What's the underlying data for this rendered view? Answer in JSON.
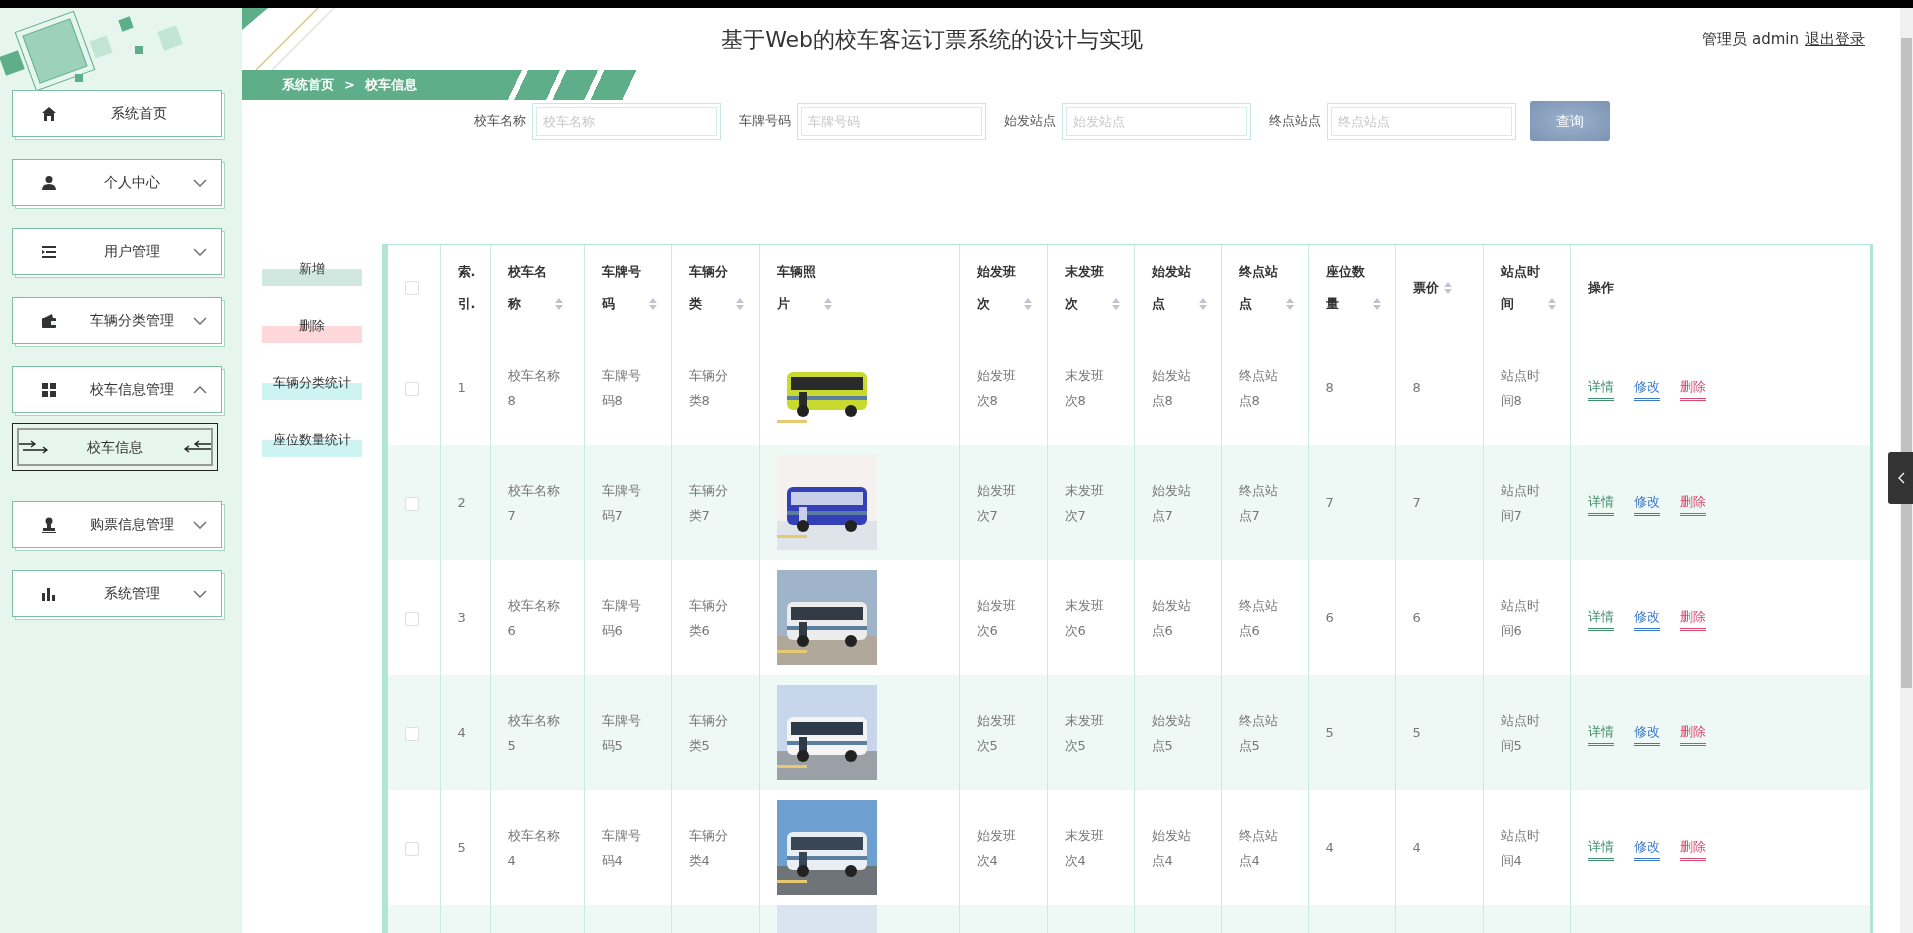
{
  "header": {
    "title": "基于Web的校车客运订票系统的设计与实现",
    "user": "管理员 admin",
    "logout": "退出登录"
  },
  "breadcrumb": {
    "home": "系统首页",
    "separator": ">",
    "current": "校车信息"
  },
  "sidebar": {
    "items": [
      {
        "label": "系统首页"
      },
      {
        "label": "个人中心",
        "expanded": false
      },
      {
        "label": "用户管理",
        "expanded": false
      },
      {
        "label": "车辆分类管理",
        "expanded": false
      },
      {
        "label": "校车信息管理",
        "expanded": true,
        "children": [
          {
            "label": "校车信息",
            "selected": true
          }
        ]
      },
      {
        "label": "购票信息管理",
        "expanded": false
      },
      {
        "label": "系统管理",
        "expanded": false
      }
    ]
  },
  "search": {
    "fields": [
      {
        "label": "校车名称",
        "placeholder": "校车名称"
      },
      {
        "label": "车牌号码",
        "placeholder": "车牌号码"
      },
      {
        "label": "始发站点",
        "placeholder": "始发站点"
      },
      {
        "label": "终点站点",
        "placeholder": "终点站点"
      }
    ],
    "button": "查询"
  },
  "actions": [
    {
      "label": "新增",
      "kind": "add"
    },
    {
      "label": "删除",
      "kind": "delete"
    },
    {
      "label": "车辆分类统计",
      "kind": "stat"
    },
    {
      "label": "座位数量统计",
      "kind": "stat"
    }
  ],
  "table": {
    "select_all": {
      "checked": false
    },
    "columns": [
      {
        "label": "索.引.",
        "sortable": false
      },
      {
        "label": "校车名称",
        "sortable": true
      },
      {
        "label": "车牌号码",
        "sortable": true
      },
      {
        "label": "车辆分类",
        "sortable": true
      },
      {
        "label": "车辆照片",
        "sortable": true
      },
      {
        "label": "始发班次",
        "sortable": true
      },
      {
        "label": "末发班次",
        "sortable": true
      },
      {
        "label": "始发站点",
        "sortable": true
      },
      {
        "label": "终点站点",
        "sortable": true
      },
      {
        "label": "座位数量",
        "sortable": true
      },
      {
        "label": "票价",
        "sortable": true
      },
      {
        "label": "站点时间",
        "sortable": true
      },
      {
        "label": "操作",
        "sortable": false
      }
    ],
    "rows": [
      {
        "checked": false,
        "cells": [
          "1",
          "校车名称8",
          "车牌号码8",
          "车辆分类8",
          {
            "kind": "picture"
          },
          "始发班次8",
          "末发班次8",
          "始发站点8",
          "终点站点8",
          "8",
          "8",
          "站点时间8"
        ],
        "actions": [
          {
            "label": "详情",
            "kind": "detail"
          },
          {
            "label": "修改",
            "kind": "edit"
          },
          {
            "label": "删除",
            "kind": "delete"
          }
        ]
      },
      {
        "checked": false,
        "cells": [
          "2",
          "校车名称7",
          "车牌号码7",
          "车辆分类7",
          {
            "kind": "picture"
          },
          "始发班次7",
          "末发班次7",
          "始发站点7",
          "终点站点7",
          "7",
          "7",
          "站点时间7"
        ],
        "actions": [
          {
            "label": "详情",
            "kind": "detail"
          },
          {
            "label": "修改",
            "kind": "edit"
          },
          {
            "label": "删除",
            "kind": "delete"
          }
        ]
      },
      {
        "checked": false,
        "cells": [
          "3",
          "校车名称6",
          "车牌号码6",
          "车辆分类6",
          {
            "kind": "picture"
          },
          "始发班次6",
          "末发班次6",
          "始发站点6",
          "终点站点6",
          "6",
          "6",
          "站点时间6"
        ],
        "actions": [
          {
            "label": "详情",
            "kind": "detail"
          },
          {
            "label": "修改",
            "kind": "edit"
          },
          {
            "label": "删除",
            "kind": "delete"
          }
        ]
      },
      {
        "checked": false,
        "cells": [
          "4",
          "校车名称5",
          "车牌号码5",
          "车辆分类5",
          {
            "kind": "picture"
          },
          "始发班次5",
          "末发班次5",
          "始发站点5",
          "终点站点5",
          "5",
          "5",
          "站点时间5"
        ],
        "actions": [
          {
            "label": "详情",
            "kind": "detail"
          },
          {
            "label": "修改",
            "kind": "edit"
          },
          {
            "label": "删除",
            "kind": "delete"
          }
        ]
      },
      {
        "checked": false,
        "cells": [
          "5",
          "校车名称4",
          "车牌号码4",
          "车辆分类4",
          {
            "kind": "picture"
          },
          "始发班次4",
          "末发班次4",
          "始发站点4",
          "终点站点4",
          "4",
          "4",
          "站点时间4"
        ],
        "actions": [
          {
            "label": "详情",
            "kind": "detail"
          },
          {
            "label": "修改",
            "kind": "edit"
          },
          {
            "label": "删除",
            "kind": "delete"
          }
        ]
      },
      {
        "kind": "cut",
        "cells": [
          {
            "kind": "picture"
          }
        ]
      }
    ]
  }
}
